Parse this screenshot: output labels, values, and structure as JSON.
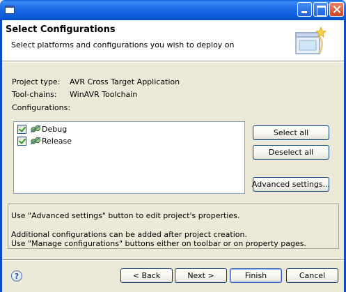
{
  "window": {
    "controls": {
      "minimize": "minimize-icon",
      "maximize": "maximize-icon",
      "close": "close-icon"
    }
  },
  "header": {
    "title": "Select Configurations",
    "description": "Select platforms and configurations you wish to deploy on",
    "icon": "wizard-banner-icon"
  },
  "info": {
    "project_type_label": "Project type:",
    "project_type_value": "AVR Cross Target Application",
    "toolchains_label": "Tool-chains:",
    "toolchains_value": "WinAVR Toolchain",
    "configurations_label": "Configurations:"
  },
  "configurations": [
    {
      "label": "Debug",
      "checked": true,
      "icon": "configuration-icon"
    },
    {
      "label": "Release",
      "checked": true,
      "icon": "configuration-icon"
    }
  ],
  "side_buttons": {
    "select_all": "Select all",
    "deselect_all": "Deselect all",
    "advanced": "Advanced settings..."
  },
  "messages": {
    "line1": "Use \"Advanced settings\" button to edit project's properties.",
    "line2": "Additional configurations can be added after project creation.",
    "line3": "Use \"Manage configurations\" buttons either on toolbar or on property pages."
  },
  "footer": {
    "help_glyph": "?",
    "back": "< Back",
    "next": "Next >",
    "finish": "Finish",
    "cancel": "Cancel"
  },
  "colors": {
    "titlebar": "#0a58d6",
    "dialog_bg": "#ece9d8",
    "checkmark": "#21a121",
    "default_button_border": "#2a54bb"
  }
}
